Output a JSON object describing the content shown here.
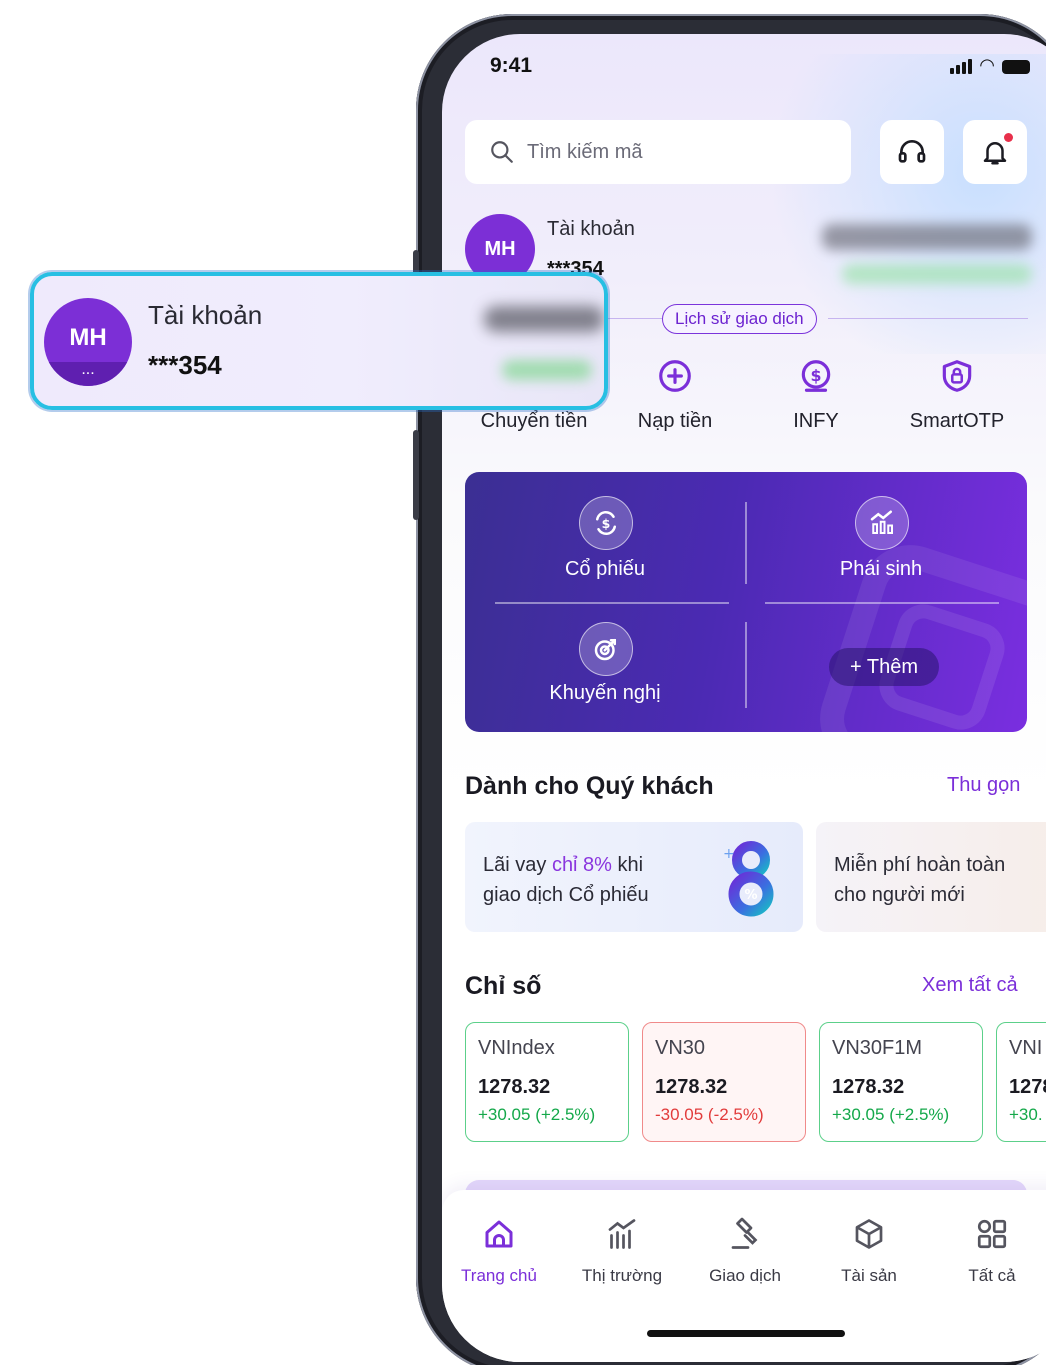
{
  "status_bar": {
    "time": "9:41"
  },
  "search": {
    "placeholder": "Tìm kiếm mã"
  },
  "account": {
    "initials": "MH",
    "label": "Tài khoản",
    "number": "***354",
    "avatar_menu": "..."
  },
  "history_link": "Lịch sử giao dịch",
  "quick_actions": [
    {
      "label": "Chuyển tiền",
      "icon": "transfer-icon"
    },
    {
      "label": "Nạp tiền",
      "icon": "plus-circle-icon"
    },
    {
      "label": "INFY",
      "icon": "coin-icon"
    },
    {
      "label": "SmartOTP",
      "icon": "shield-lock-icon"
    }
  ],
  "feature_card": {
    "stocks": "Cổ phiếu",
    "derivatives": "Phái sinh",
    "recommendations": "Khuyến nghị",
    "more": "+ Thêm"
  },
  "for_you": {
    "title": "Dành cho Quý khách",
    "link": "Thu gọn",
    "promos": [
      {
        "text_before": "Lãi vay ",
        "highlight": "chỉ 8%",
        "text_after": " khi",
        "line2": "giao dịch Cổ phiếu"
      },
      {
        "line1": "Miễn phí hoàn toàn",
        "line2": "cho người mới"
      }
    ]
  },
  "indices": {
    "title": "Chỉ số",
    "link": "Xem tất cả",
    "items": [
      {
        "name": "VNIndex",
        "value": "1278.32",
        "change": "+30.05 (+2.5%)",
        "trend": "up"
      },
      {
        "name": "VN30",
        "value": "1278.32",
        "change": "-30.05 (-2.5%)",
        "trend": "down"
      },
      {
        "name": "VN30F1M",
        "value": "1278.32",
        "change": "+30.05 (+2.5%)",
        "trend": "up"
      },
      {
        "name": "VNI",
        "value": "1278",
        "change": "+30.",
        "trend": "up"
      }
    ]
  },
  "bottom_nav": [
    {
      "label": "Trang chủ",
      "icon": "home-icon",
      "active": true
    },
    {
      "label": "Thị trường",
      "icon": "market-chart-icon",
      "active": false
    },
    {
      "label": "Giao dịch",
      "icon": "gavel-icon",
      "active": false
    },
    {
      "label": "Tài sản",
      "icon": "cube-icon",
      "active": false
    },
    {
      "label": "Tất cả",
      "icon": "grid-icon",
      "active": false
    }
  ],
  "colors": {
    "brand": "#7b2fd9",
    "up": "#14a84a",
    "down": "#e23b3b",
    "callout_border": "#27bfe3"
  }
}
